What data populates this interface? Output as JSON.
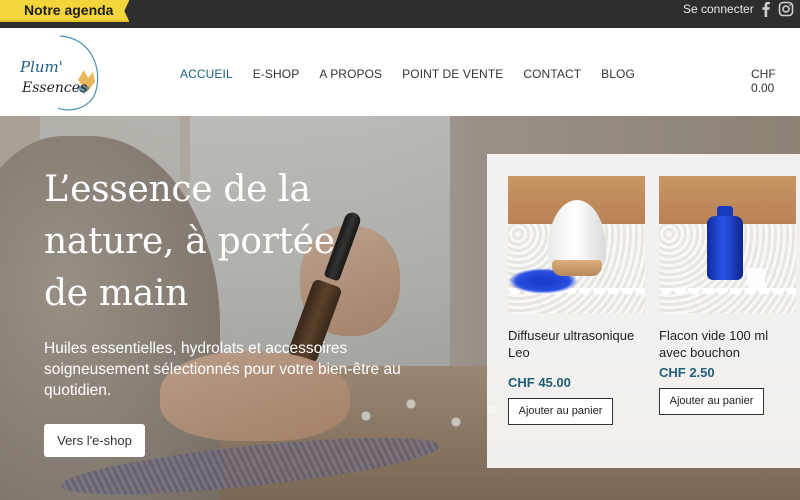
{
  "topbar": {
    "agenda_label": "Notre agenda",
    "login_label": "Se connecter",
    "social": [
      "facebook-icon",
      "instagram-icon"
    ]
  },
  "header": {
    "logo_text_line1": "Plum'",
    "logo_text_line2": "Essences",
    "nav": [
      {
        "label": "ACCUEIL",
        "active": true
      },
      {
        "label": "E-SHOP"
      },
      {
        "label": "A PROPOS"
      },
      {
        "label": "POINT DE VENTE"
      },
      {
        "label": "CONTACT"
      },
      {
        "label": "BLOG"
      }
    ],
    "cart_label": "CHF 0.00"
  },
  "hero": {
    "title": "L’essence de la nature, à portée de main",
    "subtitle": "Huiles essentielles, hydrolats et accessoires soigneusement sélectionnés pour votre bien-être au quotidien.",
    "button_label": "Vers l'e-shop"
  },
  "products": [
    {
      "name": "Diffuseur ultrasonique Leo",
      "price": "CHF 45.00",
      "button_label": "Ajouter au panier"
    },
    {
      "name": "Flacon vide 100 ml avec bouchon",
      "price": "CHF 2.50",
      "button_label": "Ajouter au panier"
    }
  ],
  "colors": {
    "accent": "#1e6079",
    "topbar": "#2e2e2e",
    "agenda_tag": "#f2d43b"
  }
}
